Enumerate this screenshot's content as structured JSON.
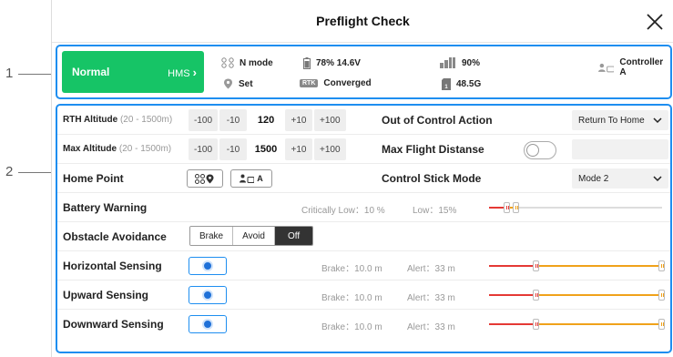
{
  "callouts": {
    "one": "1",
    "two": "2"
  },
  "header": {
    "title": "Preflight Check"
  },
  "status": {
    "normal_label": "Normal",
    "hms_label": "HMS",
    "flight_mode": "N mode",
    "home": "Set",
    "battery": "78% 14.6V",
    "rtk_badge": "RTK",
    "rtk_status": "Converged",
    "signal": "90%",
    "storage": "48.5G",
    "controller": "Controller A"
  },
  "settings": {
    "rth_altitude": {
      "label": "RTH Altitude",
      "range": "(20 - 1500m)",
      "minus100": "-100",
      "minus10": "-10",
      "value": "120",
      "plus10": "+10",
      "plus100": "+100"
    },
    "max_altitude": {
      "label": "Max Altitude",
      "range": "(20 - 1500m)",
      "minus100": "-100",
      "minus10": "-10",
      "value": "1500",
      "plus10": "+10",
      "plus100": "+100"
    },
    "out_of_control": {
      "label": "Out of Control Action",
      "value": "Return To Home"
    },
    "max_flight_distance": {
      "label": "Max Flight Distanse",
      "enabled": false
    },
    "home_point": {
      "label": "Home Point",
      "controller_btn": "A"
    },
    "control_stick": {
      "label": "Control Stick Mode",
      "value": "Mode 2"
    },
    "battery_warning": {
      "label": "Battery Warning",
      "critical": "Critically Low：10 %",
      "low": "Low：15%",
      "critical_pct": 10,
      "low_pct": 15
    },
    "obstacle": {
      "label": "Obstacle Avoidance",
      "options": [
        "Brake",
        "Avoid",
        "Off"
      ],
      "selected": "Off"
    },
    "horizontal": {
      "label": "Horizontal Sensing",
      "brake": "Brake：10.0 m",
      "alert": "Alert：33 m"
    },
    "upward": {
      "label": "Upward Sensing",
      "brake": "Brake：10.0 m",
      "alert": "Alert：33 m"
    },
    "downward": {
      "label": "Downward Sensing",
      "brake": "Brake：10.0 m",
      "alert": "Alert：33 m"
    }
  },
  "colors": {
    "accent": "#1e8ef0",
    "normal": "#16c466",
    "brake": "#e53935",
    "alert": "#f0a21a"
  }
}
